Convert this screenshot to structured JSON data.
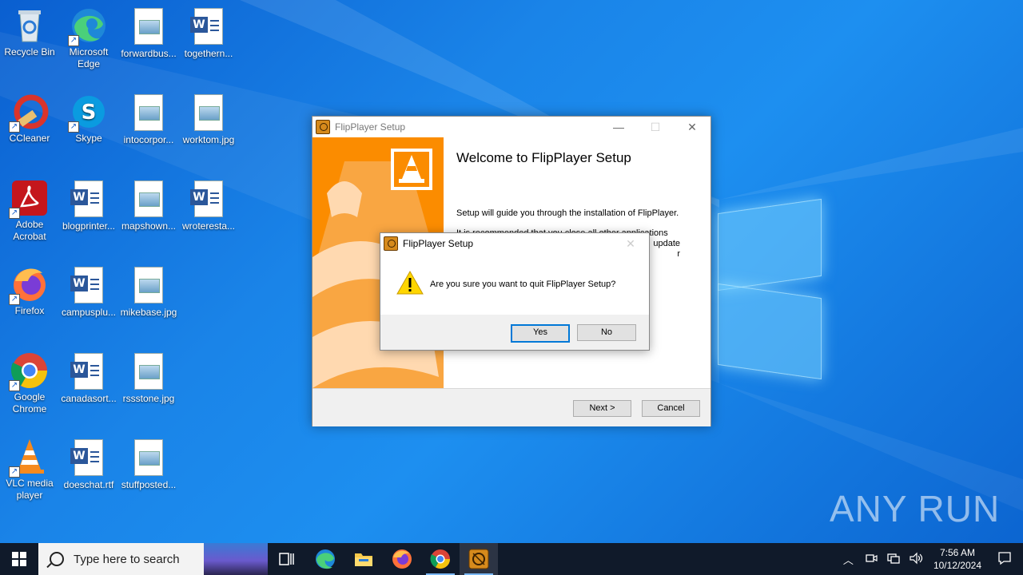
{
  "desktop": {
    "icons": [
      {
        "label": "Recycle Bin"
      },
      {
        "label": "Microsoft Edge"
      },
      {
        "label": "forwardbus..."
      },
      {
        "label": "togethern..."
      },
      {
        "label": "CCleaner"
      },
      {
        "label": "Skype"
      },
      {
        "label": "intocorpor..."
      },
      {
        "label": "worktom.jpg"
      },
      {
        "label": "Adobe Acrobat"
      },
      {
        "label": "blogprinter..."
      },
      {
        "label": "mapshown..."
      },
      {
        "label": "wroteresta..."
      },
      {
        "label": "Firefox"
      },
      {
        "label": "campusplu..."
      },
      {
        "label": "mikebase.jpg"
      },
      {
        "label": "Google Chrome"
      },
      {
        "label": "canadasort..."
      },
      {
        "label": "rssstone.jpg"
      },
      {
        "label": "VLC media player"
      },
      {
        "label": "doeschat.rtf"
      },
      {
        "label": "stuffposted..."
      }
    ]
  },
  "setup_window": {
    "title": "FlipPlayer Setup",
    "heading": "Welcome to FlipPlayer Setup",
    "intro": "Setup will guide you through the installation of FlipPlayer.",
    "partial_lines": [
      "It is recommended that you close all other applications",
      "update",
      "r"
    ],
    "next_label": "Next >",
    "cancel_label": "Cancel"
  },
  "confirm_dialog": {
    "title": "FlipPlayer Setup",
    "message": "Are you sure you want to quit FlipPlayer Setup?",
    "yes_label": "Yes",
    "no_label": "No"
  },
  "taskbar": {
    "search_placeholder": "Type here to search",
    "time": "7:56 AM",
    "date": "10/12/2024"
  },
  "watermark": "ANY RUN",
  "colors": {
    "accent": "#0078d7",
    "vlc_orange": "#fb8c00",
    "taskbar_bg": "#101a2a"
  }
}
